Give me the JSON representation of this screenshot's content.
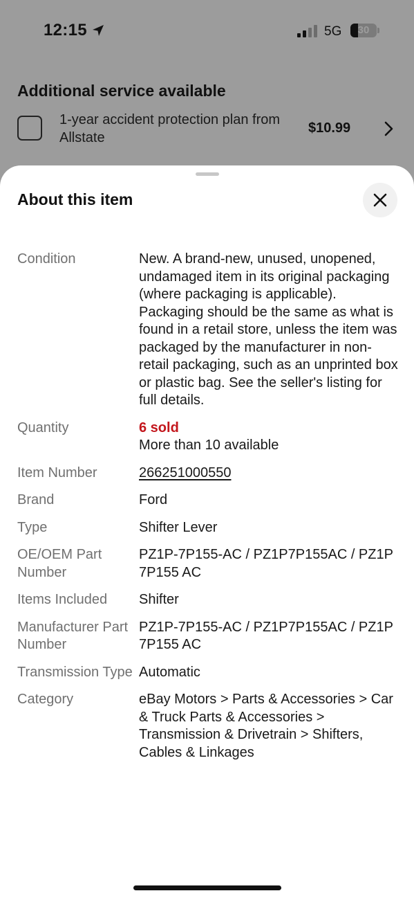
{
  "status_bar": {
    "time": "12:15",
    "network": "5G",
    "battery_level": "30",
    "battery_percent": 30,
    "signal_bars": 2,
    "icons": [
      "location-arrow-icon",
      "cellular-signal-icon",
      "battery-icon"
    ]
  },
  "background": {
    "service_title": "Additional service available",
    "service_option": "1-year accident protection plan from Allstate",
    "service_price": "$10.99",
    "icons": [
      "checkbox-icon",
      "chevron-right-icon"
    ]
  },
  "sheet": {
    "title": "About this item",
    "close_icon": "close-icon"
  },
  "details": {
    "condition": {
      "label": "Condition",
      "value": "New. A brand-new, unused, unopened, undamaged item in its original packaging (where packaging is applicable). Packaging should be the same as what is found in a retail store, unless the item was packaged by the manufacturer in non-retail packaging, such as an unprinted box or plastic bag. See the seller's listing for full details."
    },
    "quantity": {
      "label": "Quantity",
      "sold": "6 sold",
      "available": "More than 10 available"
    },
    "item_number": {
      "label": "Item Number",
      "value": "266251000550"
    },
    "brand": {
      "label": "Brand",
      "value": "Ford"
    },
    "type": {
      "label": "Type",
      "value": "Shifter Lever"
    },
    "oe_oem": {
      "label": "OE/OEM Part Number",
      "value": "PZ1P-7P155-AC / PZ1P7P155AC / PZ1P 7P155 AC"
    },
    "items_included": {
      "label": "Items Included",
      "value": "Shifter"
    },
    "manufacturer_part": {
      "label": "Manufacturer Part Number",
      "value": "PZ1P-7P155-AC / PZ1P7P155AC / PZ1P 7P155 AC"
    },
    "transmission_type": {
      "label": "Transmission Type",
      "value": "Automatic"
    },
    "category": {
      "label": "Category",
      "value": "eBay Motors > Parts & Accessories > Car & Truck Parts & Accessories > Transmission & Drivetrain > Shifters, Cables & Linkages"
    }
  },
  "colors": {
    "overlay_bg": "#9c9c9c",
    "sold_red": "#c3161c",
    "label_gray": "#707070"
  }
}
